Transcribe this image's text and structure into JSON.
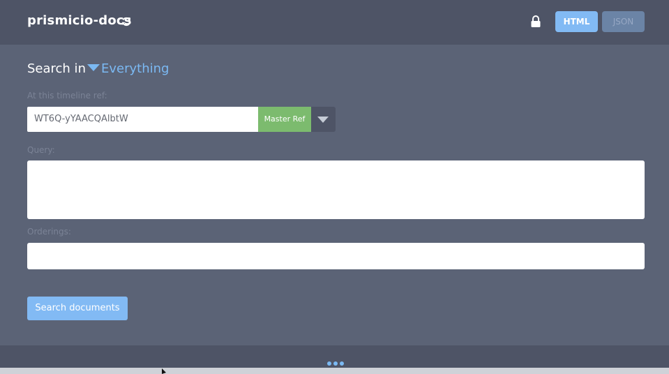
{
  "header": {
    "repo_name": "prismicio-docs",
    "refresh_icon": "refresh-icon",
    "lock_icon": "lock-icon",
    "formats": [
      {
        "label": "HTML",
        "active": true
      },
      {
        "label": "JSON",
        "active": false
      }
    ]
  },
  "search": {
    "search_in_label": "Search in",
    "scope_value": "Everything",
    "timeline_label": "At this timeline ref:",
    "ref_value": "WT6Q-yYAACQAlbtW",
    "ref_badge": "Master Ref",
    "query_label": "Query:",
    "query_value": "",
    "orderings_label": "Orderings:",
    "orderings_value": "",
    "submit_label": "Search documents"
  },
  "colors": {
    "accent": "#82baf4",
    "badge_green": "#7cbb6e",
    "panel": "#5b6376",
    "header": "#4e5466"
  },
  "footer": {
    "more_icon": "more-dots-icon"
  }
}
